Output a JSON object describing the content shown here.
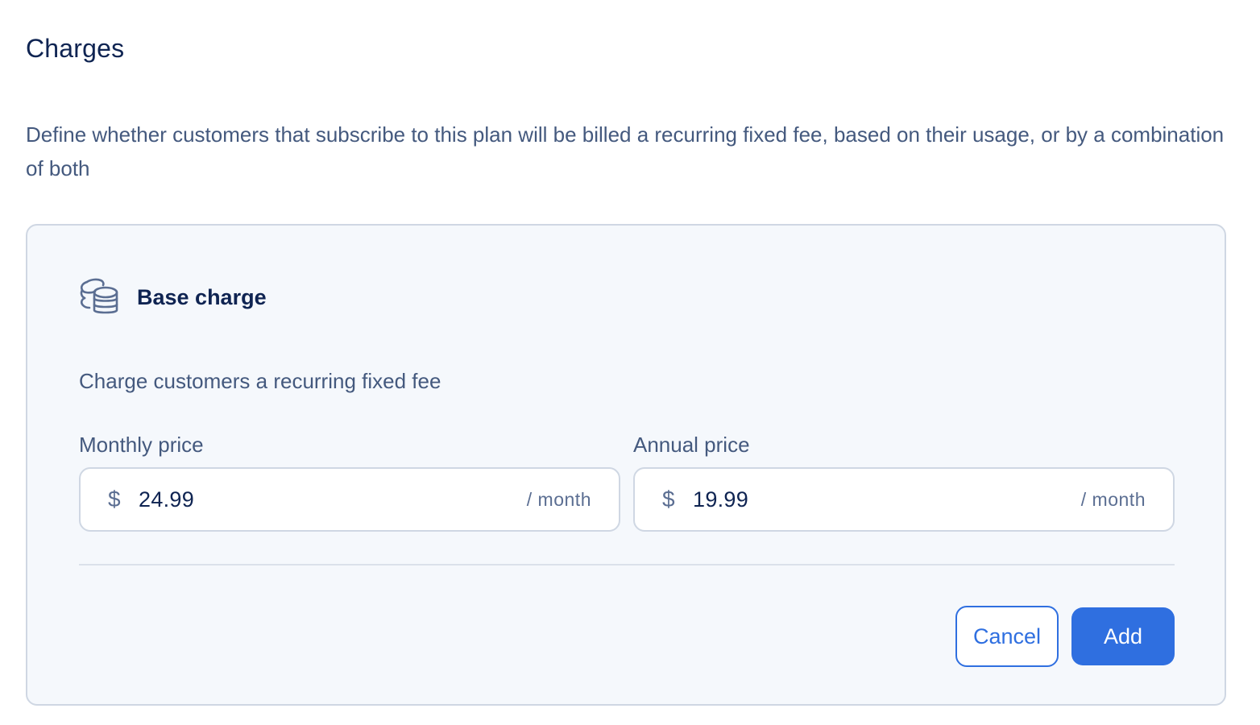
{
  "section": {
    "title": "Charges",
    "description": "Define whether customers that subscribe to this plan will be billed a recurring fixed fee, based on their usage, or by a combination of both"
  },
  "card": {
    "icon": "coins-icon",
    "title": "Base charge",
    "description": "Charge customers a recurring fixed fee",
    "monthly": {
      "label": "Monthly price",
      "currency": "$",
      "value": "24.99",
      "suffix": "/ month"
    },
    "annual": {
      "label": "Annual price",
      "currency": "$",
      "value": "19.99",
      "suffix": "/ month"
    },
    "actions": {
      "cancel_label": "Cancel",
      "add_label": "Add"
    }
  },
  "colors": {
    "primary": "#2f6fe0",
    "heading": "#0f2452",
    "text": "#44597e",
    "card_bg": "#f5f8fc",
    "border": "#cfd7e3"
  }
}
